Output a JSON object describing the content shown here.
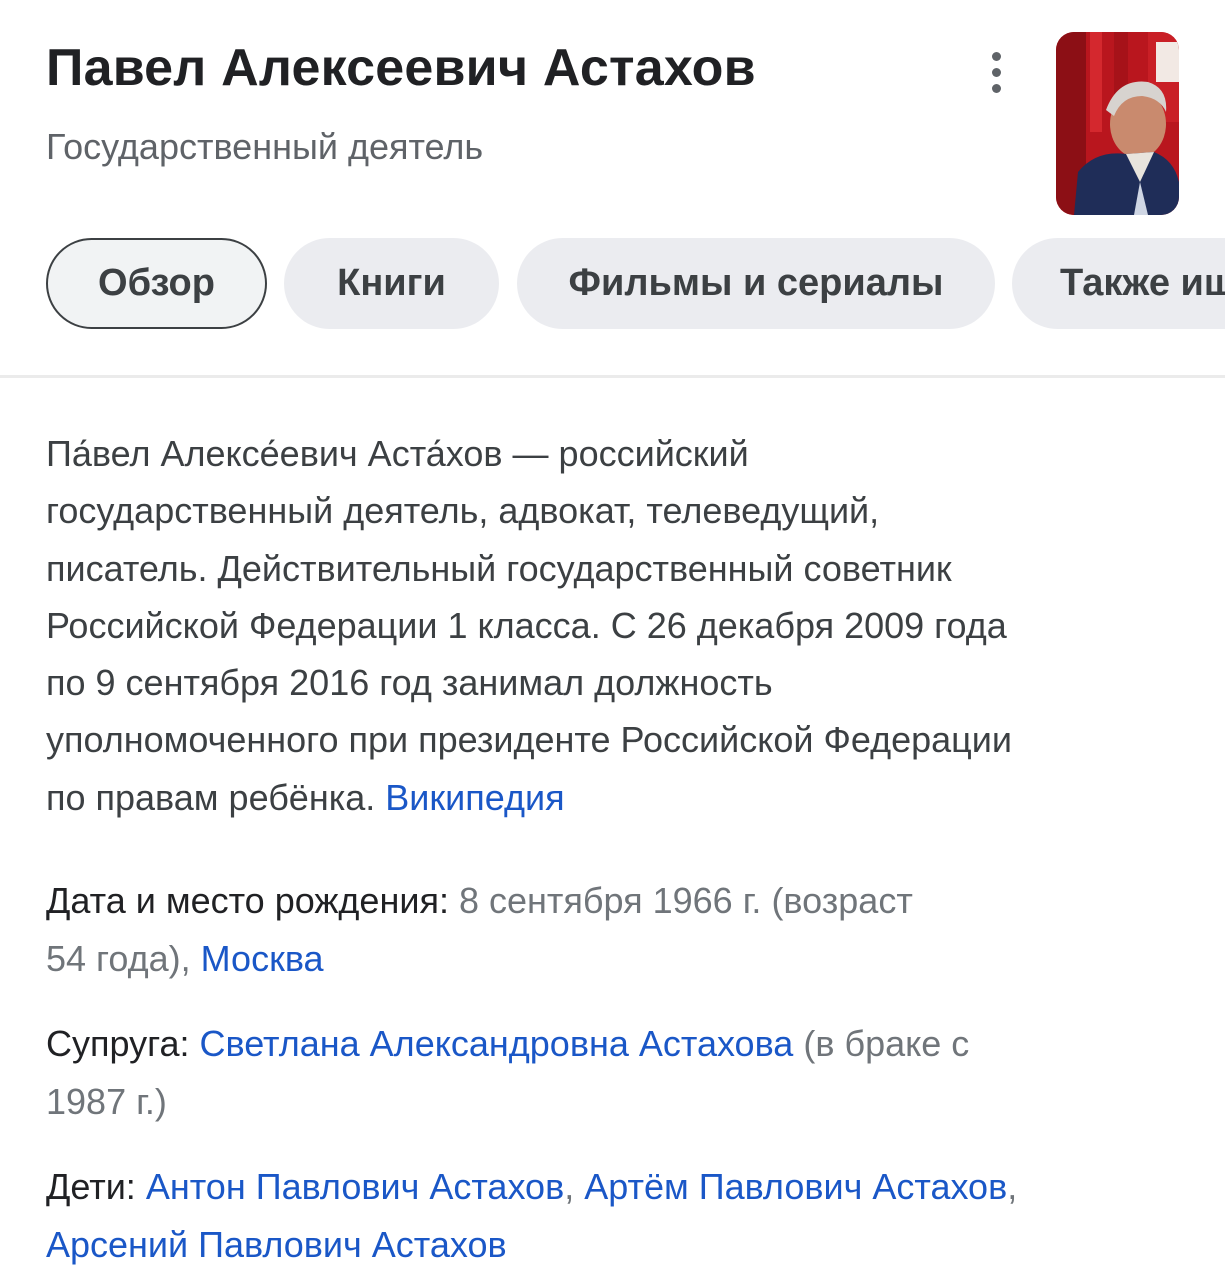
{
  "header": {
    "title": "Павел Алексеевич Астахов",
    "subtitle": "Государственный деятель",
    "photo_icon": "person-photo"
  },
  "tabs": [
    {
      "label": "Обзор",
      "active": true
    },
    {
      "label": "Книги"
    },
    {
      "label": "Фильмы и сериалы"
    },
    {
      "label": "Также ищут"
    }
  ],
  "description": {
    "lines": [
      "Па́вел Алексе́евич Аста́хов — российский",
      "государственный деятель, адвокат, телеведущий,",
      "писатель. Действительный государственный советник",
      "Российской Федерации 1 класса. С 26 декабря 2009 года",
      "по 9 сентября 2016 год занимал должность",
      "уполномоченного при президенте Российской Федерации",
      "по правам ребёнка."
    ],
    "source_link": "Википедия"
  },
  "facts": {
    "birth": {
      "label": "Дата и место рождения:",
      "value_line1": "8 сентября 1966 г. (возраст",
      "value_line2": "54 года),",
      "place_link": "Москва"
    },
    "spouse": {
      "label": "Супруга:",
      "link": "Светлана Александровна Астахова",
      "note_line1": "(в браке с",
      "note_line2": "1987 г.)"
    },
    "children": {
      "label": "Дети:",
      "links": [
        "Антон Павлович Астахов",
        "Артём Павлович Астахов",
        "Арсений Павлович Астахов"
      ],
      "separator": ","
    }
  },
  "colors": {
    "link": "#1a57c7",
    "muted": "#70757a",
    "text": "#202124",
    "chip_bg": "#ebecf0"
  }
}
